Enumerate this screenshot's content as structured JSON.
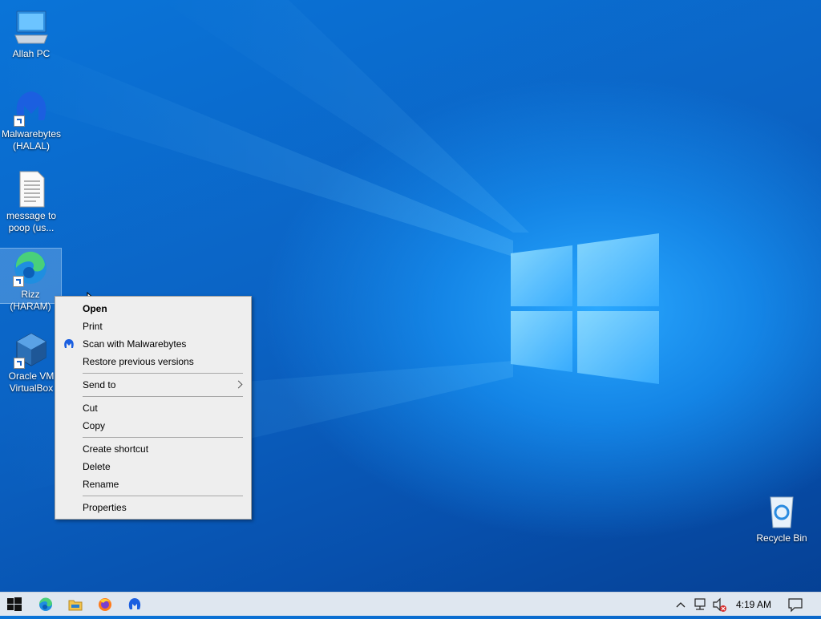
{
  "desktop": {
    "icons": [
      {
        "label": "Allah PC",
        "icon": "this-pc-icon"
      },
      {
        "label": "Malwarebytes (HALAL)",
        "icon": "malwarebytes-icon"
      },
      {
        "label": "message to poop (us...",
        "icon": "text-document-icon"
      },
      {
        "label": "Rizz (HARAM)",
        "icon": "edge-icon"
      },
      {
        "label": "Oracle VM VirtualBox",
        "icon": "virtualbox-icon"
      },
      {
        "label": "Recycle Bin",
        "icon": "recycle-bin-icon"
      }
    ]
  },
  "context_menu": {
    "open": "Open",
    "print": "Print",
    "scan": "Scan with Malwarebytes",
    "restore": "Restore previous versions",
    "send_to": "Send to",
    "cut": "Cut",
    "copy": "Copy",
    "create_shortcut": "Create shortcut",
    "delete": "Delete",
    "rename": "Rename",
    "properties": "Properties"
  },
  "taskbar": {
    "apps": [
      "start-icon",
      "edge-icon",
      "file-explorer-icon",
      "firefox-icon",
      "malwarebytes-icon"
    ],
    "clock": "4:19 AM"
  },
  "colors": {
    "desktop_blue": "#0b63c4",
    "taskbar": "#dfe7f0",
    "menu_bg": "#eeeeee"
  }
}
